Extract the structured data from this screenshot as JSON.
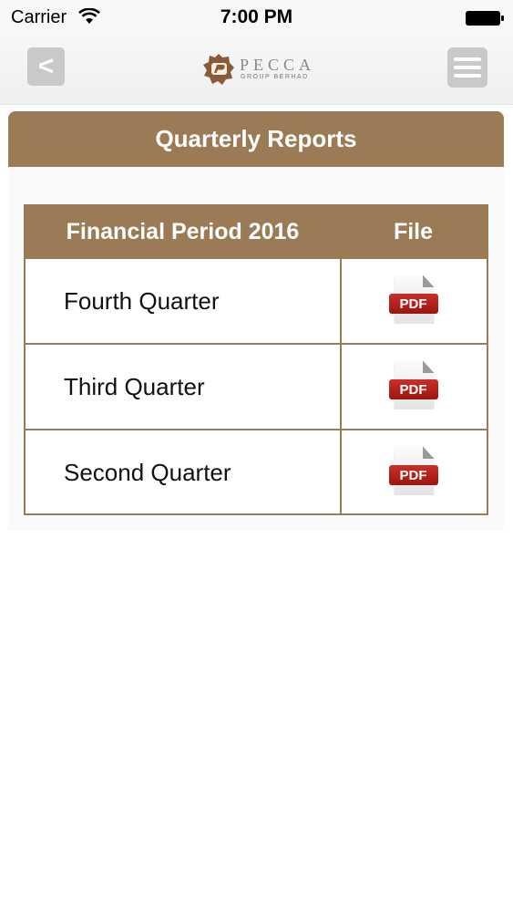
{
  "status_bar": {
    "carrier": "Carrier",
    "time": "7:00 PM",
    "icons": [
      "wifi-icon",
      "battery-icon"
    ]
  },
  "nav": {
    "back_label": "<",
    "logo": {
      "name": "PECCA",
      "subtitle": "GROUP BERHAD"
    },
    "menu_icon": "hamburger-icon"
  },
  "page": {
    "title": "Quarterly Reports"
  },
  "table": {
    "headers": [
      "Financial Period 2016",
      "File"
    ],
    "rows": [
      {
        "period": "Fourth Quarter",
        "file_label": "PDF"
      },
      {
        "period": "Third Quarter",
        "file_label": "PDF"
      },
      {
        "period": "Second Quarter",
        "file_label": "PDF"
      }
    ]
  },
  "colors": {
    "brand": "#9b7b56",
    "button_gray": "#c9c9c9",
    "pdf_red": "#b3221c"
  }
}
